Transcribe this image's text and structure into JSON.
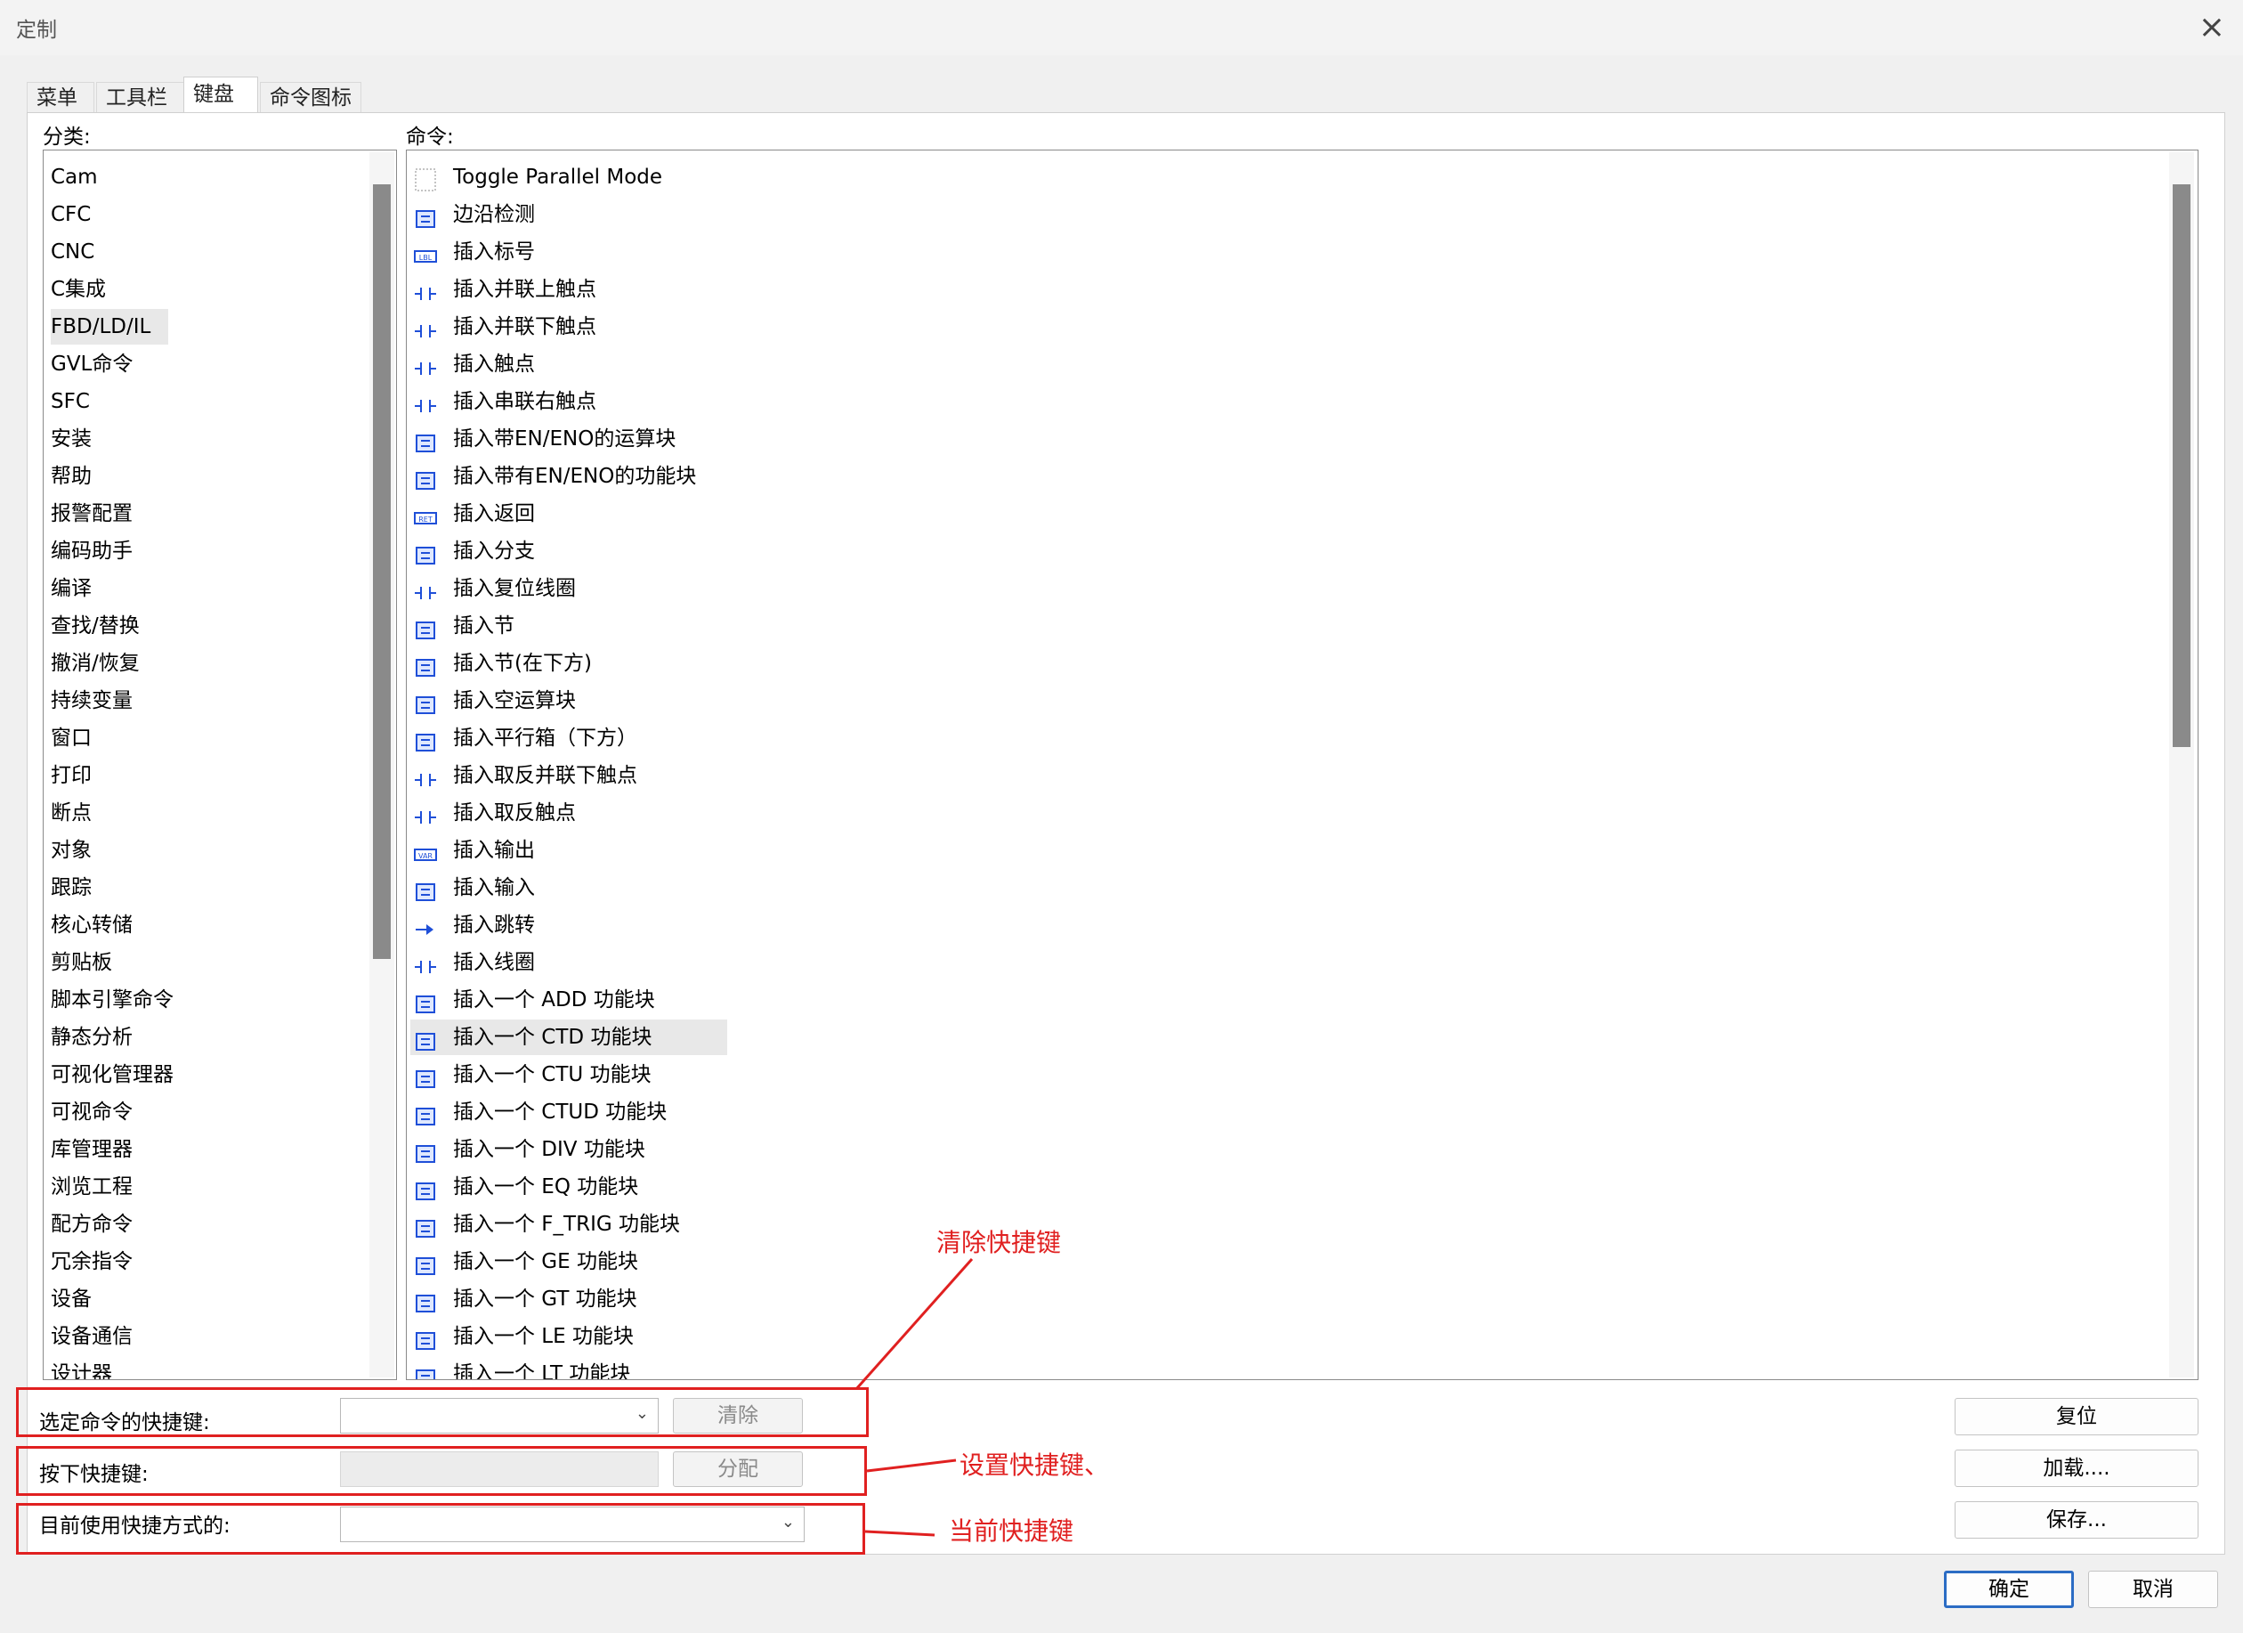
{
  "window": {
    "title": "定制",
    "close_glyph": "×"
  },
  "tabs": [
    {
      "label": "菜单",
      "active": false
    },
    {
      "label": "工具栏",
      "active": false
    },
    {
      "label": "键盘",
      "active": true
    },
    {
      "label": "命令图标",
      "active": false
    }
  ],
  "categories_label": "分类:",
  "commands_label": "命令:",
  "categories": [
    "Cam",
    "CFC",
    "CNC",
    "C集成",
    "FBD/LD/IL",
    "GVL命令",
    "SFC",
    "安装",
    "帮助",
    "报警配置",
    "编码助手",
    "编译",
    "查找/替换",
    "撤消/恢复",
    "持续变量",
    "窗口",
    "打印",
    "断点",
    "对象",
    "跟踪",
    "核心转储",
    "剪贴板",
    "脚本引擎命令",
    "静态分析",
    "可视化管理器",
    "可视命令",
    "库管理器",
    "浏览工程",
    "配方命令",
    "冗余指令",
    "设备",
    "设备通信",
    "设计器"
  ],
  "selected_category": "FBD/LD/IL",
  "commands": [
    {
      "label": "Toggle Parallel Mode",
      "icon": "empty-icon"
    },
    {
      "label": "边沿检测",
      "icon": "edge-detect-icon"
    },
    {
      "label": "插入标号",
      "icon": "label-icon"
    },
    {
      "label": "插入并联上触点",
      "icon": "parallel-contact-above-icon"
    },
    {
      "label": "插入并联下触点",
      "icon": "parallel-contact-below-icon"
    },
    {
      "label": "插入触点",
      "icon": "contact-icon"
    },
    {
      "label": "插入串联右触点",
      "icon": "series-contact-right-icon"
    },
    {
      "label": "插入带EN/ENO的运算块",
      "icon": "box-en-eno-icon"
    },
    {
      "label": "插入带有EN/ENO的功能块",
      "icon": "fb-en-eno-icon"
    },
    {
      "label": "插入返回",
      "icon": "return-icon"
    },
    {
      "label": "插入分支",
      "icon": "branch-icon"
    },
    {
      "label": "插入复位线圈",
      "icon": "reset-coil-icon"
    },
    {
      "label": "插入节",
      "icon": "network-icon"
    },
    {
      "label": "插入节(在下方)",
      "icon": "network-below-icon"
    },
    {
      "label": "插入空运算块",
      "icon": "empty-box-icon"
    },
    {
      "label": "插入平行箱（下方）",
      "icon": "parallel-box-icon"
    },
    {
      "label": "插入取反并联下触点",
      "icon": "negated-parallel-contact-icon"
    },
    {
      "label": "插入取反触点",
      "icon": "negated-contact-icon"
    },
    {
      "label": "插入输出",
      "icon": "output-var-icon"
    },
    {
      "label": "插入输入",
      "icon": "input-icon"
    },
    {
      "label": "插入跳转",
      "icon": "jump-icon"
    },
    {
      "label": "插入线圈",
      "icon": "coil-icon"
    },
    {
      "label": "插入一个 ADD 功能块",
      "icon": "add-block-icon"
    },
    {
      "label": "插入一个 CTD 功能块",
      "icon": "ctd-block-icon"
    },
    {
      "label": "插入一个 CTU 功能块",
      "icon": "ctu-block-icon"
    },
    {
      "label": "插入一个 CTUD 功能块",
      "icon": "ctud-block-icon"
    },
    {
      "label": "插入一个 DIV 功能块",
      "icon": "div-block-icon"
    },
    {
      "label": "插入一个 EQ 功能块",
      "icon": "eq-block-icon"
    },
    {
      "label": "插入一个 F_TRIG 功能块",
      "icon": "ftrig-block-icon"
    },
    {
      "label": "插入一个 GE 功能块",
      "icon": "ge-block-icon"
    },
    {
      "label": "插入一个 GT 功能块",
      "icon": "gt-block-icon"
    },
    {
      "label": "插入一个 LE 功能块",
      "icon": "le-block-icon"
    },
    {
      "label": "插入一个 LT 功能块",
      "icon": "lt-block-icon"
    }
  ],
  "selected_command": "插入一个 CTD 功能块",
  "shortcut": {
    "selected_label": "选定命令的快捷键:",
    "selected_value": "",
    "clear_button": "清除",
    "press_label": "按下快捷键:",
    "press_value": "",
    "assign_button": "分配",
    "current_label": "目前使用快捷方式的:",
    "current_value": ""
  },
  "side_buttons": {
    "reset": "复位",
    "load": "加载....",
    "save": "保存..."
  },
  "footer": {
    "ok": "确定",
    "cancel": "取消"
  },
  "annotations": {
    "clear": "清除快捷键",
    "set": "设置快捷键、",
    "current": "当前快捷键"
  },
  "colors": {
    "annotation": "#e02020",
    "icon_blue": "#1f4fd8",
    "primary_border": "#2b6cc4"
  }
}
